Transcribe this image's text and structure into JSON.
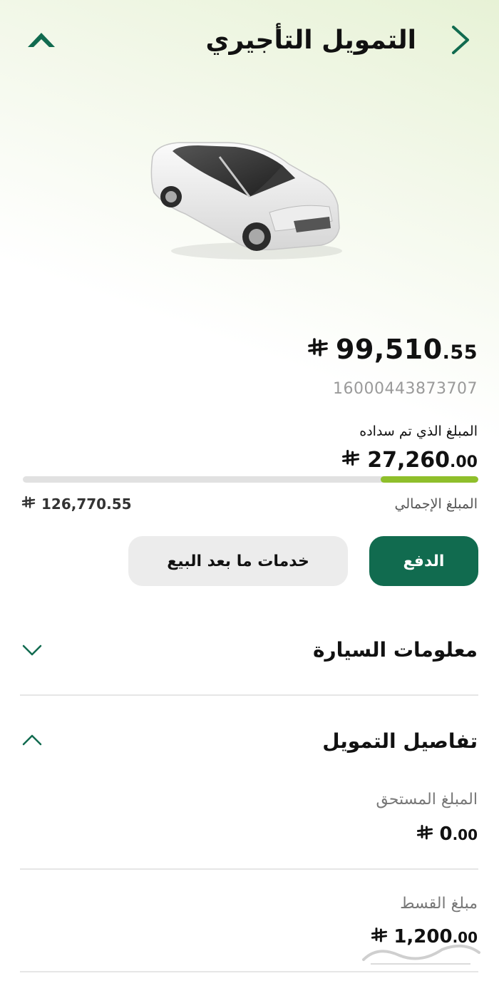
{
  "header": {
    "title": "التمويل التأجيري"
  },
  "summary": {
    "balance": {
      "integer": "99,510",
      "decimal": ".55"
    },
    "contract_number": "16000443873707",
    "paid_label": "المبلغ الذي تم سداده",
    "paid": {
      "integer": "27,260",
      "decimal": ".00"
    },
    "progress_fraction": 0.215,
    "total_label": "المبلغ الإجمالي",
    "total_value": "126,770.55"
  },
  "actions": {
    "pay_label": "الدفع",
    "after_sales_label": "خدمات ما بعد البيع"
  },
  "sections": {
    "car_info": {
      "title": "معلومات السيارة",
      "expanded": false
    },
    "financing": {
      "title": "تفاصيل التمويل",
      "expanded": true,
      "due_label": "المبلغ المستحق",
      "due": {
        "integer": "0",
        "decimal": ".00"
      },
      "installment_label": "مبلغ القسط",
      "installment": {
        "integer": "1,200",
        "decimal": ".00"
      }
    }
  },
  "watermark": "حراج",
  "colors": {
    "brand_green": "#116b4f",
    "progress_green": "#8fbf2b",
    "muted_gray": "#9a9a9a"
  },
  "icons": {
    "back": "chevron-right-icon",
    "logo": "brand-logo-icon",
    "currency": "saudi-riyal-icon",
    "collapsed": "chevron-down-icon",
    "expanded": "chevron-up-icon"
  }
}
